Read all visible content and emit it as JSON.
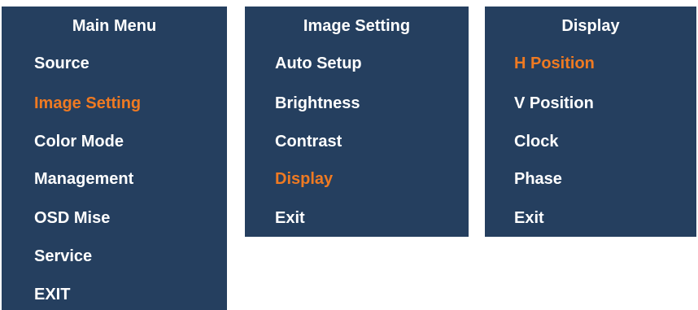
{
  "colors": {
    "panel_background": "#253f5f",
    "text": "#ffffff",
    "highlight": "#ef7a22",
    "page_background": "#ffffff"
  },
  "main_menu": {
    "title": "Main Menu",
    "items": [
      {
        "label": "Source",
        "active": false
      },
      {
        "label": "Image Setting",
        "active": true
      },
      {
        "label": "Color Mode",
        "active": false
      },
      {
        "label": "Management",
        "active": false
      },
      {
        "label": "OSD Mise",
        "active": false
      },
      {
        "label": "Service",
        "active": false
      },
      {
        "label": "EXIT",
        "active": false
      }
    ]
  },
  "image_setting_menu": {
    "title": "Image Setting",
    "items": [
      {
        "label": "Auto Setup",
        "active": false
      },
      {
        "label": "Brightness",
        "active": false
      },
      {
        "label": "Contrast",
        "active": false
      },
      {
        "label": "Display",
        "active": true
      },
      {
        "label": "Exit",
        "active": false
      }
    ]
  },
  "display_menu": {
    "title": "Display",
    "items": [
      {
        "label": "H Position",
        "active": true
      },
      {
        "label": "V Position",
        "active": false
      },
      {
        "label": "Clock",
        "active": false
      },
      {
        "label": "Phase",
        "active": false
      },
      {
        "label": "Exit",
        "active": false
      }
    ]
  }
}
